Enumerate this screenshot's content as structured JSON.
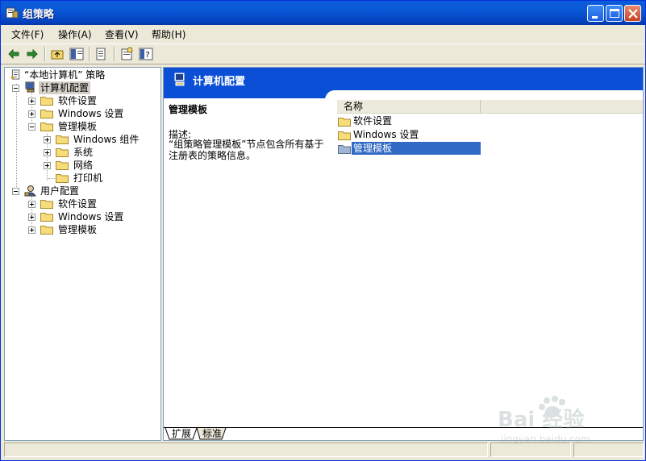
{
  "window": {
    "title": "组策略"
  },
  "menu": {
    "file": "文件(F)",
    "action": "操作(A)",
    "view": "查看(V)",
    "help": "帮助(H)"
  },
  "toolbar": {
    "icons": [
      "back-arrow-icon",
      "forward-arrow-icon",
      "up-folder-icon",
      "show-tree-icon",
      "export-list-icon",
      "properties-icon",
      "help-icon"
    ]
  },
  "tree": {
    "root": "“本地计算机” 策略",
    "computer": "计算机配置",
    "computer_children": {
      "software": "软件设置",
      "windows": "Windows 设置",
      "admin": "管理模板",
      "admin_children": {
        "components": "Windows 组件",
        "system": "系统",
        "network": "网络",
        "printers": "打印机"
      }
    },
    "user": "用户配置",
    "user_children": {
      "software": "软件设置",
      "windows": "Windows 设置",
      "admin": "管理模板"
    }
  },
  "details": {
    "header_title": "计算机配置",
    "desc_title": "管理模板",
    "desc_label": "描述:",
    "desc_text": "“组策略管理模板”节点包含所有基于注册表的策略信息。"
  },
  "list": {
    "column_name": "名称",
    "items": [
      "软件设置",
      "Windows 设置",
      "管理模板"
    ],
    "selected_index": 2
  },
  "tabs": {
    "extended": "扩展",
    "standard": "标准"
  },
  "watermark": {
    "brand": "Bai 经验",
    "url": "jingyan.baidu.com"
  },
  "colors": {
    "titlebar": "#0a58d6",
    "selection": "#316ac5",
    "header": "#0a4fd6"
  }
}
